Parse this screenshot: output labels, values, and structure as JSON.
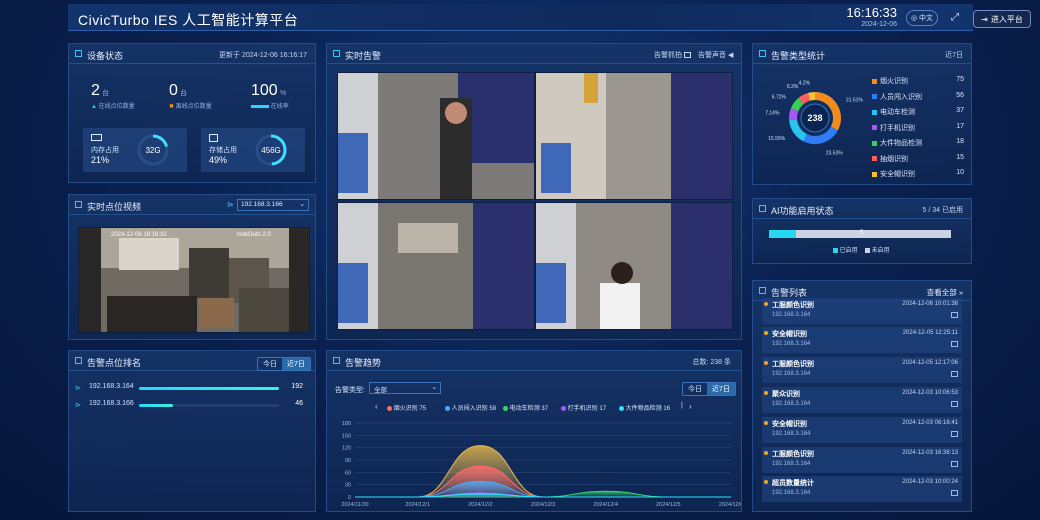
{
  "header": {
    "title": "CivicTurbo IES 人工智能计算平台",
    "time": "16:16:33",
    "date": "2024-12-06",
    "lang": "中文",
    "enter_label": "进入平台"
  },
  "device_status": {
    "title": "设备状态",
    "updated": "更新于 2024-12-06 16:16:17",
    "online": {
      "value": "2",
      "unit": "台",
      "label": "在线点位数量"
    },
    "offline": {
      "value": "0",
      "unit": "台",
      "label": "离线点位数量"
    },
    "rate": {
      "value": "100",
      "unit": "%",
      "label": "在线率"
    },
    "memory": {
      "label": "内存占用",
      "percent": "21%",
      "total": "32G",
      "fill": 0.21
    },
    "storage": {
      "label": "存储占用",
      "percent": "49%",
      "total": "456G",
      "fill": 0.49
    }
  },
  "realtime_feed": {
    "title": "实时点位视频",
    "selected_ip": "192.168.3.166",
    "overlay_date": "2024-12-06 16:16:32",
    "overlay_cam": "lookOuts 2.0"
  },
  "alarm_rank": {
    "title": "告警点位排名",
    "tabs": [
      "今日",
      "近7日"
    ],
    "rows": [
      {
        "ip": "192.168.3.164",
        "value": "192",
        "fill": 1.0
      },
      {
        "ip": "192.168.3.166",
        "value": "46",
        "fill": 0.24
      }
    ]
  },
  "live_alarm": {
    "title": "实时告警",
    "action1": "告警抓拍",
    "action2": "告警声音"
  },
  "alarm_trend": {
    "title": "告警趋势",
    "total": "总数: 238 条",
    "filter_label": "告警类型:",
    "filter_value": "全部",
    "tabs": [
      "今日",
      "近7日"
    ],
    "legend": [
      {
        "name": "烟火识别",
        "value": "75",
        "color": "#ff6b6b"
      },
      {
        "name": "人员闯入识别",
        "value": "58",
        "color": "#4aa8ff"
      },
      {
        "name": "电动车检测",
        "value": "37",
        "color": "#39d36b"
      },
      {
        "name": "打手机识别",
        "value": "17",
        "color": "#a05cff"
      },
      {
        "name": "大件物品检测",
        "value": "16",
        "color": "#2de2ff"
      }
    ]
  },
  "chart_data": {
    "type": "area",
    "x": [
      "2024/11/30",
      "2024/12/1",
      "2024/12/2",
      "2024/12/3",
      "2024/12/4",
      "2024/12/5",
      "2024/12/6"
    ],
    "ylim": [
      0,
      180
    ],
    "yticks": [
      0,
      30,
      60,
      90,
      120,
      150,
      180
    ],
    "series": [
      {
        "name": "烟火识别",
        "color": "#ff6b6b",
        "values": [
          0,
          0,
          75,
          0,
          0,
          0,
          0
        ]
      },
      {
        "name": "人员闯入识别",
        "color": "#4aa8ff",
        "values": [
          0,
          0,
          38,
          0,
          0,
          0,
          0
        ]
      },
      {
        "name": "电动车检测",
        "color": "#39d36b",
        "values": [
          0,
          0,
          0,
          0,
          14,
          0,
          0
        ]
      },
      {
        "name": "打手机识别",
        "color": "#a05cff",
        "values": [
          0,
          0,
          10,
          0,
          0,
          0,
          0
        ]
      },
      {
        "name": "大件物品检测",
        "color": "#2de2ff",
        "values": [
          0,
          0,
          8,
          0,
          0,
          0,
          0
        ]
      },
      {
        "name": "总数",
        "color": "#e8b84a",
        "values": [
          0,
          0,
          125,
          0,
          0,
          0,
          0
        ]
      }
    ]
  },
  "alarm_type_stats": {
    "title": "告警类型统计",
    "range": "近7日",
    "total": "238",
    "items": [
      {
        "name": "烟火识别",
        "value": "75",
        "color": "#f38b1f",
        "pct": "31.51%"
      },
      {
        "name": "人员闯入识别",
        "value": "56",
        "color": "#2f7cf6",
        "pct": "23.53%"
      },
      {
        "name": "电动车检测",
        "value": "37",
        "color": "#27c4f0",
        "pct": "15.55%"
      },
      {
        "name": "打手机识别",
        "value": "17",
        "color": "#a857f5",
        "pct": "7.14%"
      },
      {
        "name": "大件物品检测",
        "value": "18",
        "color": "#34d058",
        "pct": "6.72%"
      },
      {
        "name": "抽烟识别",
        "value": "15",
        "color": "#ff5f5f",
        "pct": "6.3%"
      },
      {
        "name": "安全帽识别",
        "value": "10",
        "color": "#f2c230",
        "pct": "4.2%"
      }
    ]
  },
  "ai_status": {
    "title": "AI功能启用状态",
    "count": "5 / 34 已启用",
    "fill": 0.147,
    "bar_text": "5",
    "legend_on": "已启用",
    "legend_off": "未启用"
  },
  "alarm_list": {
    "title": "告警列表",
    "view_all": "查看全部",
    "items": [
      {
        "name": "工服颜色识别",
        "ip": "192.168.3.164",
        "time": "2024-12-06 10:01:38"
      },
      {
        "name": "安全帽识别",
        "ip": "192.168.3.164",
        "time": "2024-12-05 12:25:11"
      },
      {
        "name": "工服颜色识别",
        "ip": "192.168.3.164",
        "time": "2024-12-05 12:17:06"
      },
      {
        "name": "聚众识别",
        "ip": "192.168.3.164",
        "time": "2024-12-03 10:06:53"
      },
      {
        "name": "安全帽识别",
        "ip": "192.168.3.164",
        "time": "2024-12-03 06:16:41"
      },
      {
        "name": "工服颜色识别",
        "ip": "192.168.3.164",
        "time": "2024-12-03 16:38:13"
      },
      {
        "name": "超员数量统计",
        "ip": "192.168.3.164",
        "time": "2024-12-03 10:00:24"
      }
    ]
  }
}
